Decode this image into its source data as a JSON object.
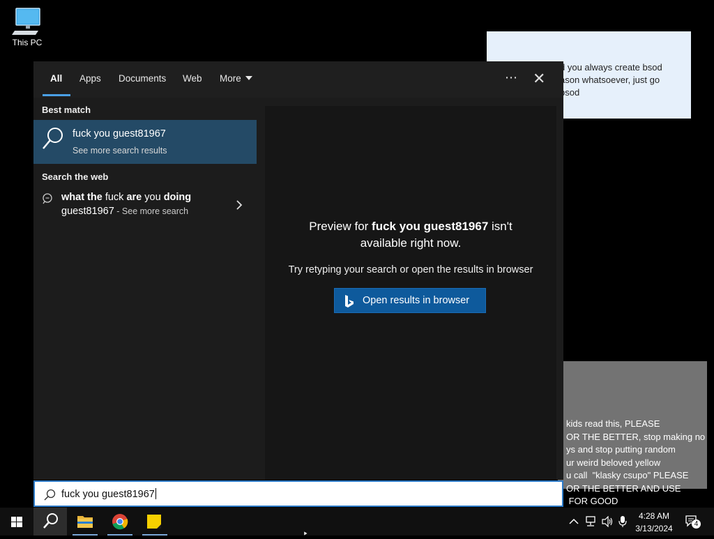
{
  "desktop": {
    "this_pc_label": "This PC"
  },
  "notes": {
    "note1": "d you always create bsod\nason whatsoever, just go\nbsod",
    "note2": "kids read this, PLEASE\nOR THE BETTER, stop making no\nys and stop putting random\nur weird beloved yellow\nu call  \"klasky csupo\" PLEASE\nOR THE BETTER AND USE\n FOR GOOD"
  },
  "search_panel": {
    "tabs": [
      {
        "label": "All"
      },
      {
        "label": "Apps"
      },
      {
        "label": "Documents"
      },
      {
        "label": "Web"
      },
      {
        "label": "More"
      }
    ],
    "best_match_header": "Best match",
    "best_match": {
      "title": "fuck you guest81967",
      "subtitle": "See more search results"
    },
    "search_web_header": "Search the web",
    "web_result": {
      "p1": "what the",
      "p2": " fuck ",
      "p3": "are",
      "p4": " you ",
      "p5": "doing",
      "line2": "guest81967",
      "sub": " - See more search"
    },
    "preview": {
      "prefix": "Preview for ",
      "query": "fuck you guest81967",
      "suffix": " isn't",
      "line2": "available right now.",
      "hint": "Try retyping your search or open the results in browser",
      "open_button": "Open results in browser"
    }
  },
  "search_box": {
    "value": "fuck you guest81967"
  },
  "taskbar": {
    "time": "4:28 AM",
    "date": "3/13/2024",
    "notification_count": "4"
  },
  "colors": {
    "accent": "#4aa0e6",
    "best_match_bg": "#244a66",
    "open_button_bg": "#0e5a9c"
  }
}
